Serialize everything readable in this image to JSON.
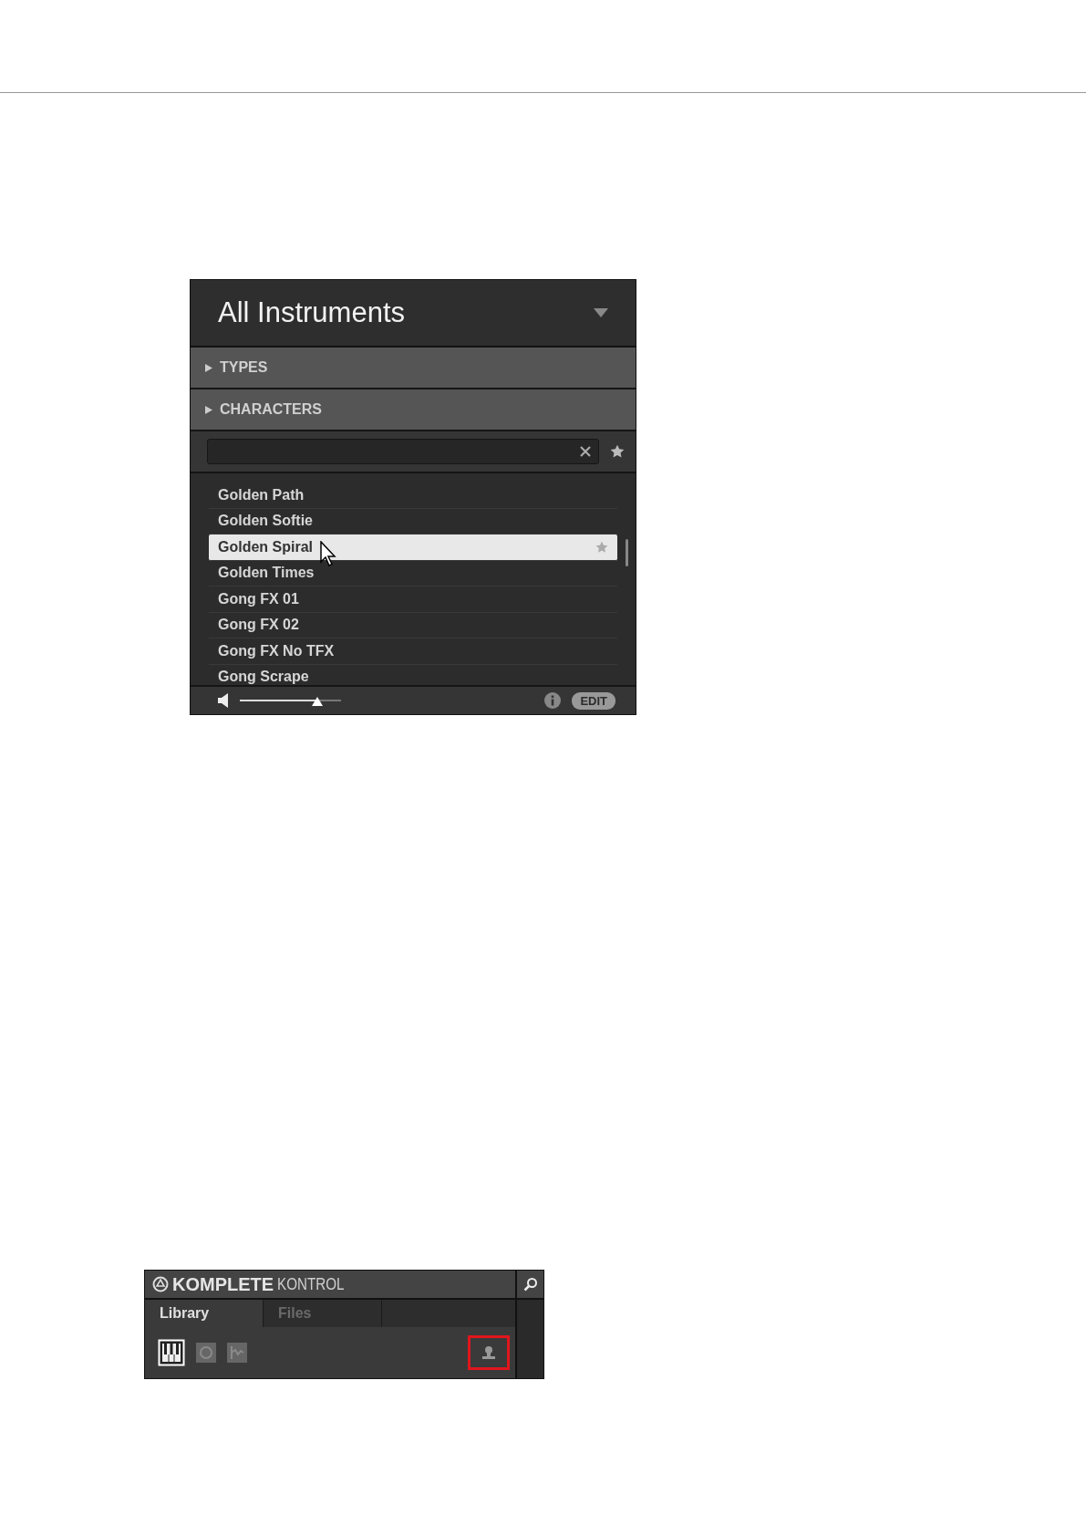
{
  "browser": {
    "title": "All Instruments",
    "filters": [
      {
        "label": "TYPES",
        "expanded": false
      },
      {
        "label": "CHARACTERS",
        "expanded": false
      }
    ],
    "results": [
      {
        "name": "Golden Path",
        "selected": false
      },
      {
        "name": "Golden Softie",
        "selected": false
      },
      {
        "name": "Golden Spiral",
        "selected": true
      },
      {
        "name": "Golden Times",
        "selected": false
      },
      {
        "name": "Gong FX 01",
        "selected": false
      },
      {
        "name": "Gong FX 02",
        "selected": false
      },
      {
        "name": "Gong FX No TFX",
        "selected": false
      },
      {
        "name": "Gong Scrape",
        "selected": false
      }
    ],
    "volume": {
      "level": 0.73
    },
    "edit_button": "EDIT"
  },
  "header": {
    "brand": "KOMPLETE",
    "product": "KONTROL",
    "tabs": [
      {
        "label": "Library",
        "selected": true
      },
      {
        "label": "Files",
        "selected": false
      }
    ],
    "content_types": [
      {
        "kind": "instruments",
        "selected": true
      },
      {
        "kind": "loops",
        "selected": false
      },
      {
        "kind": "samples",
        "selected": false
      }
    ],
    "user_button": {
      "highlighted": true
    }
  }
}
